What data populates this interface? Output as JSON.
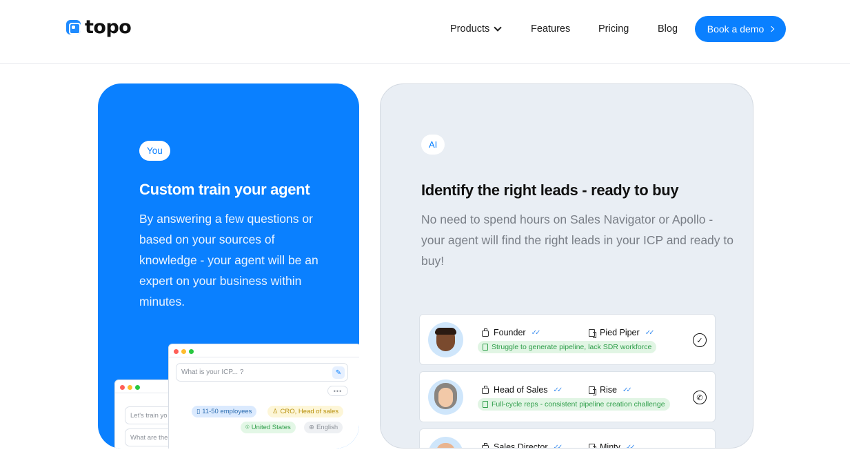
{
  "header": {
    "logo_text": "topo",
    "nav": {
      "products": "Products",
      "features": "Features",
      "pricing": "Pricing",
      "blog": "Blog"
    },
    "cta": "Book a demo"
  },
  "card_you": {
    "badge": "You",
    "title": "Custom train your agent",
    "description": "By answering a few questions or based on your sources of knowledge - your agent will be an expert on your business within minutes.",
    "back_window": {
      "input_1": "Let's train yo",
      "input_2": "What are the"
    },
    "front_window": {
      "input_placeholder": "What is your ICP... ?",
      "more": "•••",
      "tags": {
        "employees": "11-50 employees",
        "roles": "CRO, Head of sales",
        "location": "United States",
        "language": "English"
      }
    }
  },
  "card_ai": {
    "badge": "AI",
    "title": "Identify the right leads - ready to buy",
    "description": "No need to spend hours on Sales Navigator or Apollo - your agent will find the right leads in your ICP and ready to buy!",
    "leads": [
      {
        "role": "Founder",
        "company": "Pied Piper",
        "pain": "Struggle to generate pipeline, lack SDR workforce",
        "status": "✓"
      },
      {
        "role": "Head of Sales",
        "company": "Rise",
        "pain": "Full-cycle reps - consistent pipeline creation challenge",
        "status": "✆"
      },
      {
        "role": "Sales Director",
        "company": "Minty",
        "pain": "",
        "status": ""
      }
    ]
  },
  "colors": {
    "brand_blue": "#0a80ff",
    "ai_card_bg": "#e9eef4",
    "pain_green": "#2f9e4a"
  },
  "icons": {
    "nav_dropdown": "chevron-down-icon",
    "cta_arrow": "chevron-right-icon",
    "role": "briefcase-icon",
    "company": "building-icon",
    "verified": "double-check-icon"
  }
}
